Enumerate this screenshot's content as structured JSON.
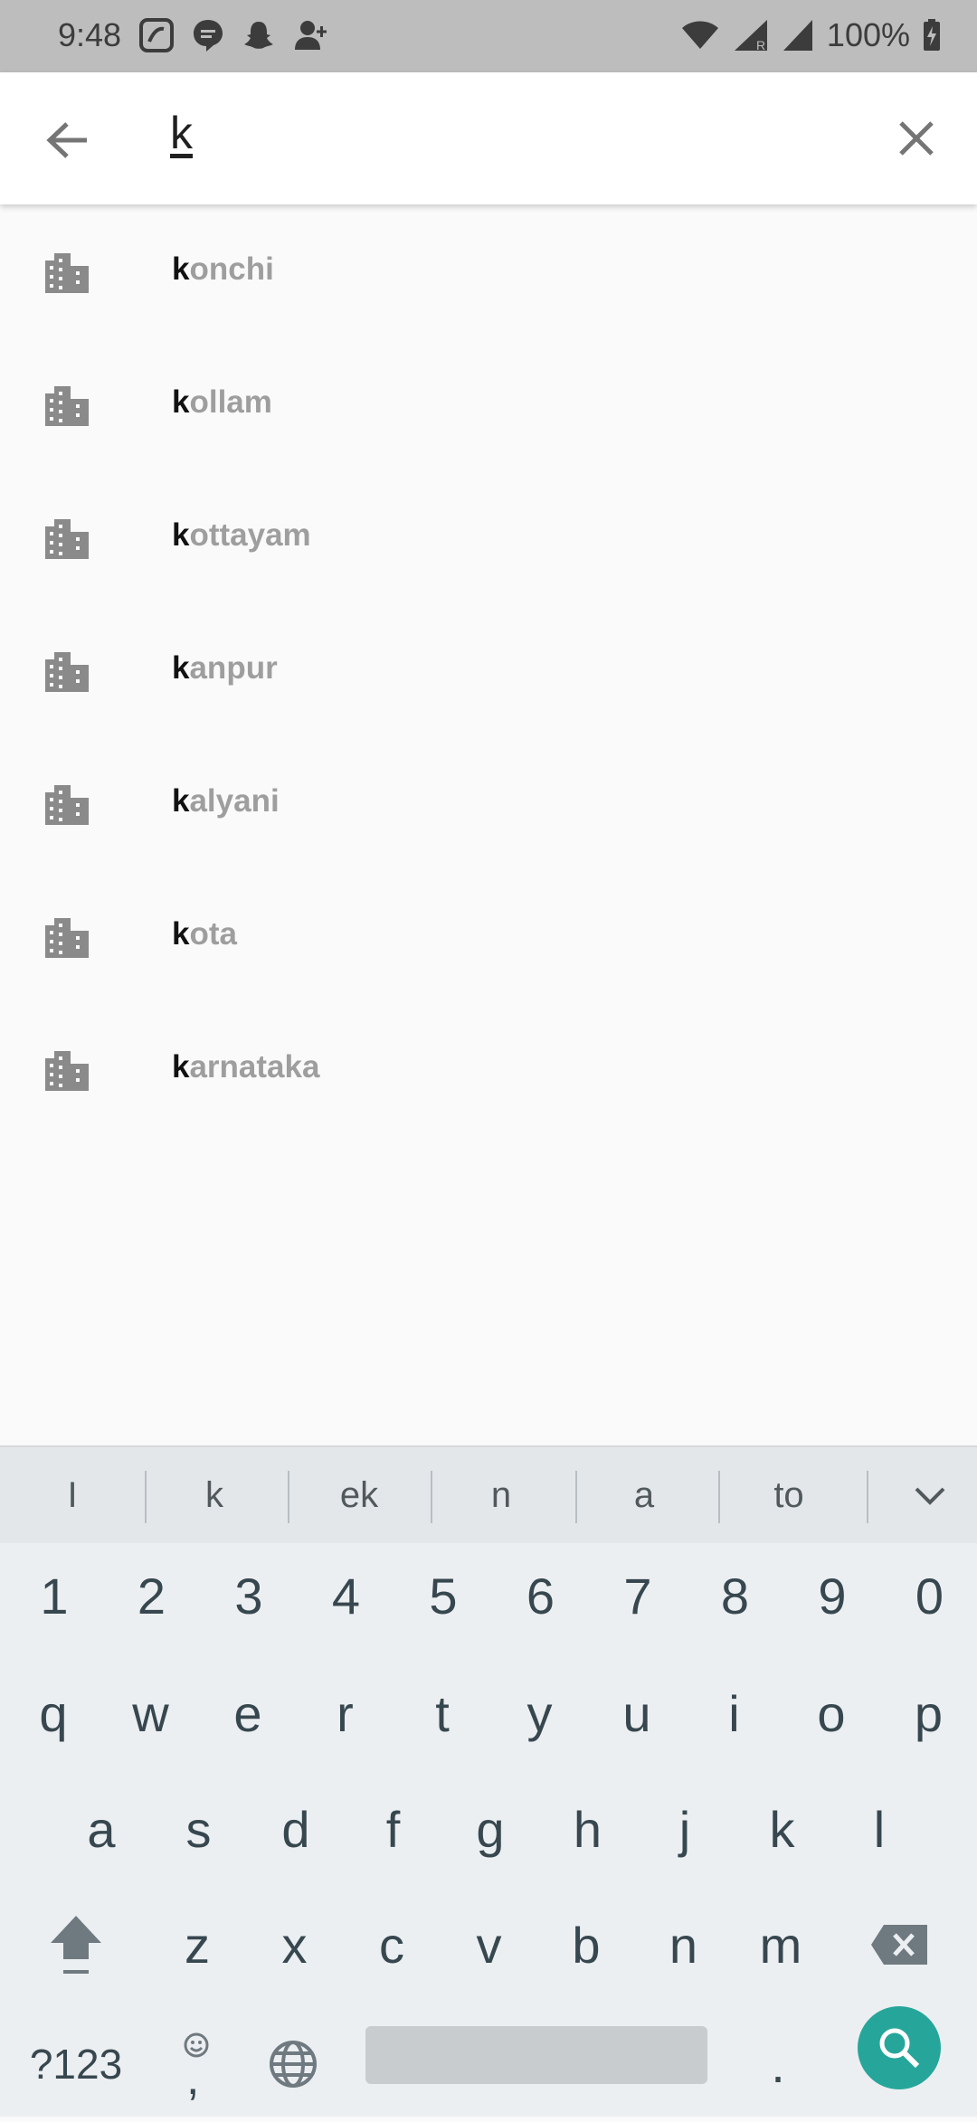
{
  "status_bar": {
    "time": "9:48",
    "battery_text": "100%",
    "icons": [
      "saavn-icon",
      "messenger-icon",
      "snapchat-icon",
      "add-person-icon",
      "wifi-icon",
      "cell-signal-roaming-icon",
      "cell-signal-icon",
      "battery-charging-icon"
    ]
  },
  "search": {
    "query": "k",
    "back_icon": "arrow-left-icon",
    "clear_icon": "close-icon"
  },
  "results": [
    {
      "match": "k",
      "rest": "onchi"
    },
    {
      "match": "k",
      "rest": "ollam"
    },
    {
      "match": "k",
      "rest": "ottayam"
    },
    {
      "match": "k",
      "rest": "anpur"
    },
    {
      "match": "k",
      "rest": "alyani"
    },
    {
      "match": "k",
      "rest": "ota"
    },
    {
      "match": "k",
      "rest": "arnataka"
    }
  ],
  "keyboard": {
    "suggestions": [
      "I",
      "k",
      "ek",
      "n",
      "a",
      "to"
    ],
    "numbers": [
      "1",
      "2",
      "3",
      "4",
      "5",
      "6",
      "7",
      "8",
      "9",
      "0"
    ],
    "row1": [
      "q",
      "w",
      "e",
      "r",
      "t",
      "y",
      "u",
      "i",
      "o",
      "p"
    ],
    "row2": [
      "a",
      "s",
      "d",
      "f",
      "g",
      "h",
      "j",
      "k",
      "l"
    ],
    "row3": [
      "z",
      "x",
      "c",
      "v",
      "b",
      "n",
      "m"
    ],
    "symbols_label": "?123",
    "comma_label": ",",
    "period_label": ".",
    "accent_color": "#26a69a"
  }
}
